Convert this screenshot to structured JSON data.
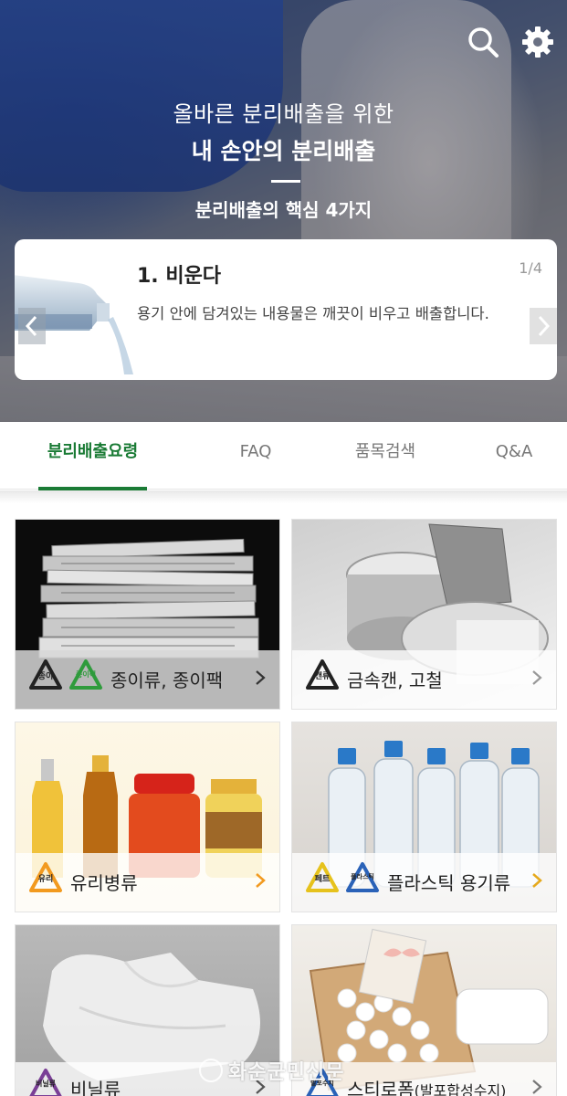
{
  "hero": {
    "line1": "올바른 분리배출을 위한",
    "line2": "내 손안의 분리배출",
    "line3": "분리배출의 핵심 4가지"
  },
  "icons": {
    "search": "search-icon",
    "settings": "gear-icon"
  },
  "tip_card": {
    "title": "1. 비운다",
    "page": "1/4",
    "body": "용기 안에 담겨있는 내용물은 깨끗이 비우고 배출합니다."
  },
  "tabs": [
    {
      "label": "분리배출요령",
      "active": true
    },
    {
      "label": "FAQ"
    },
    {
      "label": "품목검색"
    },
    {
      "label": "Q&A"
    }
  ],
  "colors": {
    "accent": "#1a7b35",
    "chevron_orange": "#f29a1f",
    "badge_green": "#2f9b3c",
    "badge_yellow": "#e6c21c",
    "badge_blue": "#2a62b8",
    "badge_orange": "#f29a1f",
    "badge_purple": "#7a3f96"
  },
  "categories": [
    {
      "label": "종이류, 종이팩",
      "badges": [
        "종이",
        "종이팩"
      ]
    },
    {
      "label": "금속캔, 고철",
      "badges": [
        "캔류"
      ]
    },
    {
      "label": "유리병류",
      "badges": [
        "유리"
      ]
    },
    {
      "label": "플라스틱 용기류",
      "badges": [
        "페트",
        "플라스틱"
      ]
    },
    {
      "label": "비닐류",
      "badges": [
        "비닐류"
      ]
    },
    {
      "label_main": "스티로폼",
      "label_sub": "(발포합성수지)",
      "badges": [
        "발포수지"
      ]
    }
  ],
  "watermark": "화순군민신문"
}
